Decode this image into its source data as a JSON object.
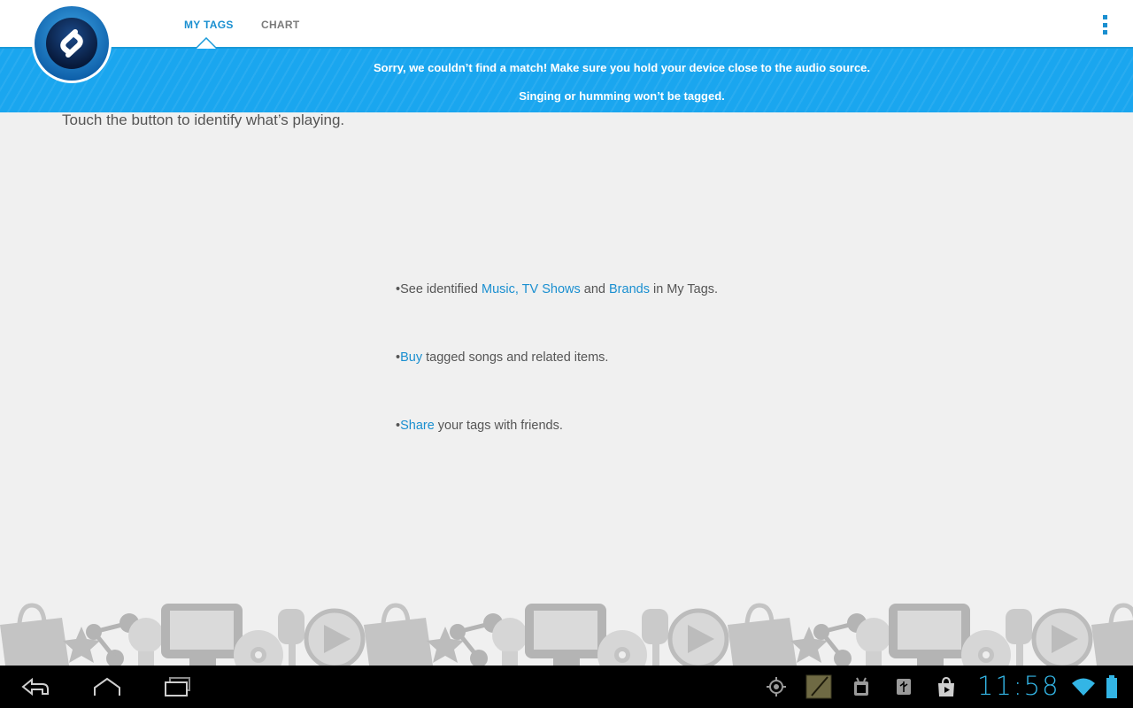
{
  "tabs": [
    {
      "label": "MY TAGS",
      "active": true
    },
    {
      "label": "CHART",
      "active": false
    }
  ],
  "banner": {
    "line1": "Sorry, we couldn’t find a match! Make sure you hold your device close to the audio source.",
    "line2": "Singing or humming won’t be tagged."
  },
  "main": {
    "instruction": "Touch the button to identify what’s playing.",
    "features": {
      "f1": {
        "bullet": "•",
        "pre": "See identified ",
        "link_music": "Music,",
        "space": " ",
        "link_tv": "TV Shows",
        "mid": " and ",
        "link_brands": "Brands",
        "post": " in My Tags."
      },
      "f2": {
        "bullet": "•",
        "link": "Buy",
        "post": " tagged songs and related items."
      },
      "f3": {
        "bullet": "•",
        "link": "Share",
        "post": " your tags with friends."
      }
    }
  },
  "statusbar": {
    "clock": "11:58",
    "icons": [
      "back-icon",
      "home-icon",
      "recent-apps-icon",
      "gps-icon",
      "notes-icon",
      "android-debug-icon",
      "usb-icon",
      "store-icon",
      "wifi-icon",
      "battery-icon"
    ]
  },
  "colors": {
    "accent": "#1a8fd0",
    "banner": "#1aa6ef",
    "clock": "#33b5e5",
    "background": "#f0f0f0"
  }
}
